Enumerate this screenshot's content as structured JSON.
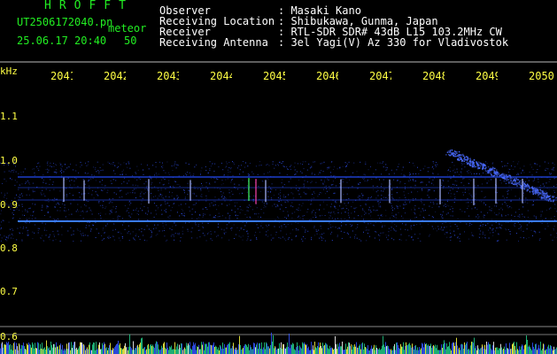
{
  "header": {
    "brand": "HROFFT",
    "filename": "UT2506172040.pn",
    "meteor_label": "meteor",
    "datetime": "25.06.17 20:40",
    "meteor_count": "50",
    "info": [
      {
        "label": "Observer",
        "value": ": Masaki Kano"
      },
      {
        "label": "Receiving Location",
        "value": ": Shibukawa, Gunma, Japan"
      },
      {
        "label": "Receiver",
        "value": ": RTL-SDR SDR# 43dB L15 103.2MHz CW"
      },
      {
        "label": "Receiving Antenna",
        "value": ": 3el Yagi(V) Az 330 for Vladivostok"
      }
    ]
  },
  "axis": {
    "unit": "kHz",
    "time_ticks": [
      "2041",
      "2042",
      "2043",
      "2044",
      "2045",
      "2046",
      "2047",
      "2048",
      "2049",
      "2050"
    ],
    "freq_ticks": [
      "1.1",
      "1.0",
      "0.9",
      "0.8",
      "0.7",
      "0.6"
    ]
  },
  "colors": {
    "text_green": "#22ee22",
    "text_white": "#ffffff",
    "axis_yellow": "#ffff44",
    "signal_blue": "#3355ff",
    "grid_grey": "#888888"
  }
}
